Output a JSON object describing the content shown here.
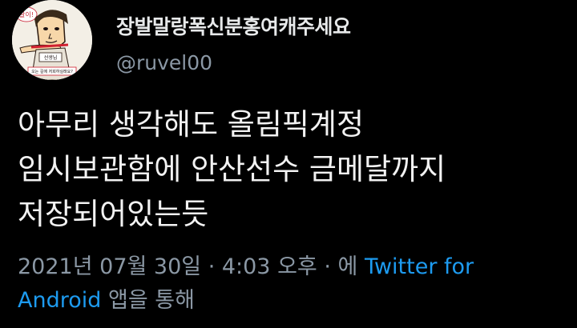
{
  "tweet": {
    "author": {
      "display_name": "장발말랑폭신분홍여캐주세요",
      "handle": "@ruvel00",
      "avatar_icon": "cartoon-character-avatar",
      "avatar_text": {
        "top": "찰이!",
        "middle": "선생님",
        "bottom": "오는 길에 저희하실래요?"
      }
    },
    "text_lines": [
      "아무리 생각해도 올림픽계정",
      "임시보관함에 안산선수 금메달까지",
      "저장되어있는듯"
    ],
    "meta": {
      "timestamp": "2021년 07월 30일 · 4:03 오후 · 에",
      "source_part1": "Twitter for",
      "source_part2": "Android",
      "via_suffix": "앱을 통해"
    },
    "colors": {
      "background": "#000000",
      "link": "#1d9bf0",
      "secondary_text": "#8b98a5"
    }
  }
}
